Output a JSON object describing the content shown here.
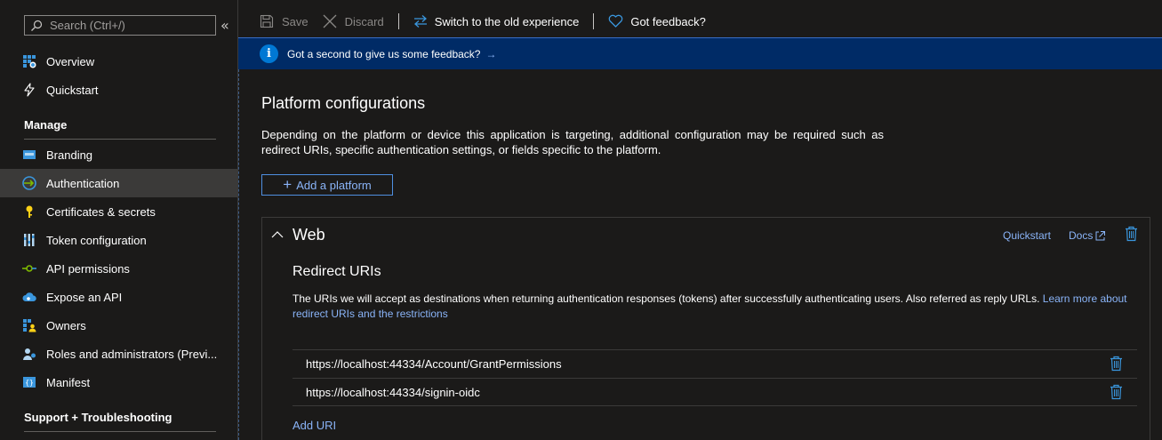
{
  "sidebar": {
    "search_placeholder": "Search (Ctrl+/)",
    "collapse_glyph": "«",
    "top_items": [
      {
        "label": "Overview",
        "icon": "grid-icon"
      },
      {
        "label": "Quickstart",
        "icon": "lightning-icon"
      }
    ],
    "manage_header": "Manage",
    "manage_items": [
      {
        "label": "Branding",
        "icon": "branding-icon"
      },
      {
        "label": "Authentication",
        "icon": "authentication-icon",
        "selected": true
      },
      {
        "label": "Certificates & secrets",
        "icon": "key-icon"
      },
      {
        "label": "Token configuration",
        "icon": "token-icon"
      },
      {
        "label": "API permissions",
        "icon": "api-permissions-icon"
      },
      {
        "label": "Expose an API",
        "icon": "cloud-icon"
      },
      {
        "label": "Owners",
        "icon": "owners-icon"
      },
      {
        "label": "Roles and administrators (Previ...",
        "icon": "roles-icon"
      },
      {
        "label": "Manifest",
        "icon": "manifest-icon"
      }
    ],
    "support_header": "Support + Troubleshooting"
  },
  "toolbar": {
    "save_label": "Save",
    "discard_label": "Discard",
    "switch_label": "Switch to the old experience",
    "feedback_label": "Got feedback?"
  },
  "banner": {
    "text": "Got a second to give us some feedback?",
    "arrow": "→"
  },
  "main": {
    "title": "Platform configurations",
    "description": "Depending on the platform or device this application is targeting, additional configuration may be required such as redirect URIs, specific authentication settings, or fields specific to the platform.",
    "add_platform_label": "Add a platform",
    "web": {
      "title": "Web",
      "quickstart_label": "Quickstart",
      "docs_label": "Docs",
      "redirect_title": "Redirect URIs",
      "redirect_desc": "The URIs we will accept as destinations when returning authentication responses (tokens) after successfully authenticating users. Also referred as reply URLs.",
      "learn_more": "Learn more about redirect URIs and the restrictions",
      "uris": [
        "https://localhost:44334/Account/GrantPermissions",
        "https://localhost:44334/signin-oidc"
      ],
      "add_uri_label": "Add URI"
    }
  },
  "colors": {
    "background": "#1b1a19",
    "selected": "#3b3a39",
    "link": "#8ab4f8",
    "banner": "#002b66",
    "accent": "#0078d4"
  }
}
